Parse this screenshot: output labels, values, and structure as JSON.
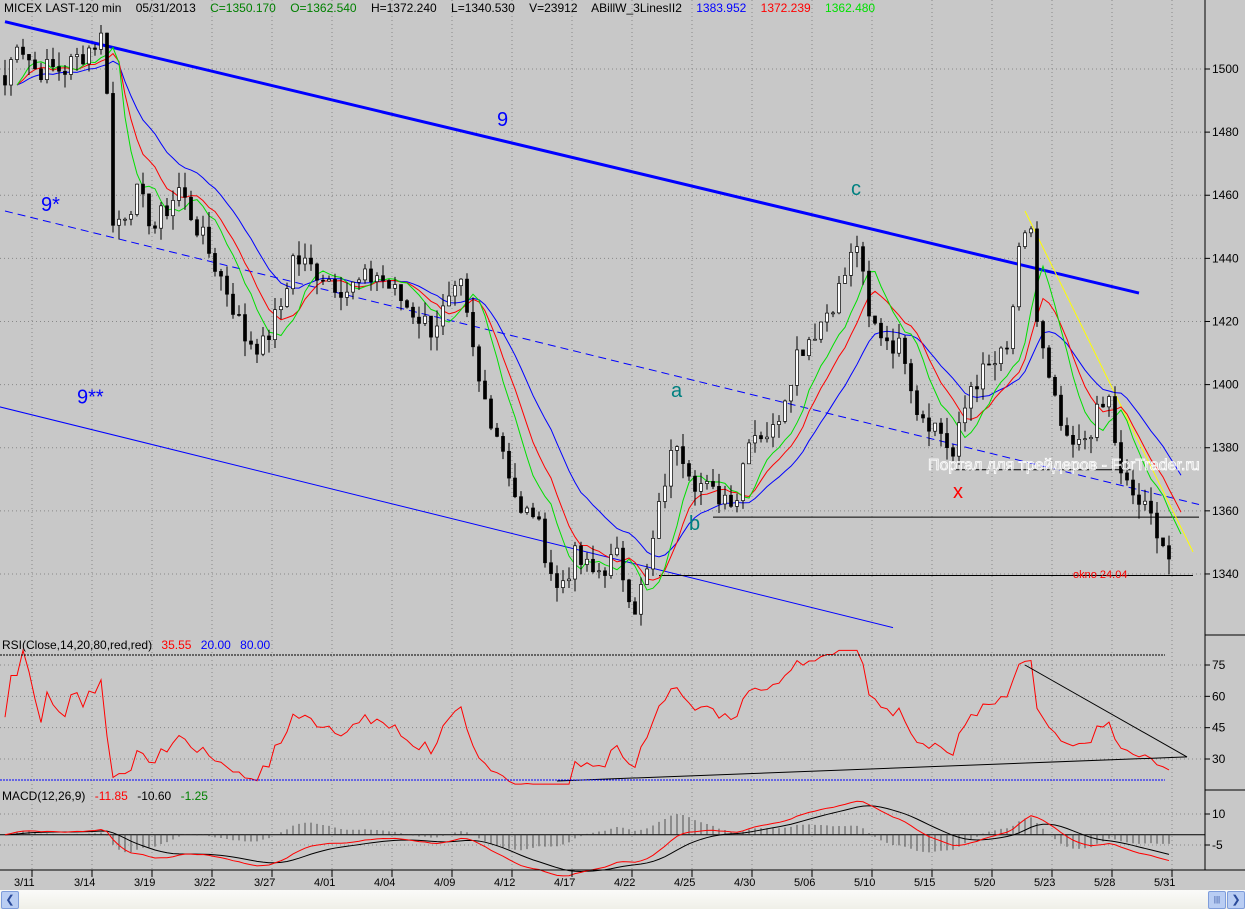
{
  "header": {
    "symbol": "MICEX LAST-120 min",
    "date": "05/31/2013",
    "close": "C=1350.170",
    "open": "O=1362.540",
    "high": "H=1372.240",
    "low": "L=1340.530",
    "volume": "V=23912",
    "indicator": "ABillW_3LinesII2",
    "ma_blue": "1383.952",
    "ma_red": "1372.239",
    "ma_green": "1362.480"
  },
  "rsi_header": {
    "label": "RSI(Close,14,20,80,red,red)",
    "value": "35.55",
    "low": "20.00",
    "high": "80.00"
  },
  "macd_header": {
    "label": "MACD(12,26,9)",
    "macd": "-11.85",
    "signal": "-10.60",
    "hist": "-1.25"
  },
  "watermark": "Портал для трейдеров - ForTrader.ru",
  "colors": {
    "bg": "#c8c8c8",
    "ma_fast": "#00e000",
    "ma_mid": "#ff0000",
    "ma_slow": "#0000ff",
    "trend": "#0000ff",
    "rsi": "#ff0000"
  },
  "chart_data": {
    "type": "candlestick",
    "title": "MICEX LAST-120 min",
    "price_ticks": [
      1340,
      1360,
      1380,
      1400,
      1420,
      1440,
      1460,
      1480,
      1500
    ],
    "ylim": [
      1318,
      1522
    ],
    "rsi_ticks": [
      "75",
      "60",
      "45",
      "30"
    ],
    "macd_ticks": [
      "10",
      "-5"
    ],
    "x_labels": [
      "3/11",
      "3/14",
      "3/19",
      "3/22",
      "3/27",
      "4/01",
      "4/04",
      "4/09",
      "4/12",
      "4/17",
      "4/22",
      "4/25",
      "4/30",
      "5/06",
      "5/10",
      "5/15",
      "5/20",
      "5/23",
      "5/28",
      "5/31"
    ],
    "close_path": [
      [
        0,
        1495
      ],
      [
        2,
        1510
      ],
      [
        5,
        1500
      ],
      [
        10,
        1500
      ],
      [
        16,
        1510
      ],
      [
        17,
        1495
      ],
      [
        18,
        1450
      ],
      [
        22,
        1460
      ],
      [
        25,
        1450
      ],
      [
        29,
        1462
      ],
      [
        32,
        1450
      ],
      [
        37,
        1430
      ],
      [
        40,
        1415
      ],
      [
        43,
        1412
      ],
      [
        46,
        1425
      ],
      [
        48,
        1440
      ],
      [
        53,
        1435
      ],
      [
        57,
        1430
      ],
      [
        62,
        1435
      ],
      [
        67,
        1425
      ],
      [
        71,
        1418
      ],
      [
        76,
        1430
      ],
      [
        79,
        1400
      ],
      [
        83,
        1380
      ],
      [
        86,
        1358
      ],
      [
        88,
        1360
      ],
      [
        92,
        1335
      ],
      [
        95,
        1345
      ],
      [
        98,
        1340
      ],
      [
        102,
        1345
      ],
      [
        105,
        1330
      ],
      [
        107,
        1340
      ],
      [
        110,
        1370
      ],
      [
        112,
        1383
      ],
      [
        115,
        1370
      ],
      [
        118,
        1365
      ],
      [
        122,
        1365
      ],
      [
        124,
        1385
      ],
      [
        128,
        1385
      ],
      [
        132,
        1410
      ],
      [
        136,
        1420
      ],
      [
        139,
        1430
      ],
      [
        142,
        1445
      ],
      [
        144,
        1420
      ],
      [
        147,
        1415
      ],
      [
        150,
        1410
      ],
      [
        152,
        1393
      ],
      [
        156,
        1385
      ],
      [
        158,
        1377
      ],
      [
        161,
        1400
      ],
      [
        164,
        1405
      ],
      [
        167,
        1410
      ],
      [
        169,
        1440
      ],
      [
        171,
        1450
      ],
      [
        172,
        1420
      ],
      [
        174,
        1400
      ],
      [
        177,
        1380
      ],
      [
        179,
        1380
      ],
      [
        182,
        1390
      ],
      [
        184,
        1395
      ],
      [
        186,
        1370
      ],
      [
        188,
        1365
      ],
      [
        192,
        1355
      ],
      [
        194,
        1345
      ]
    ],
    "trendlines": [
      {
        "name": "9",
        "from": [
          0,
          1515
        ],
        "to": [
          189,
          1429
        ],
        "style": "bold"
      },
      {
        "name": "9*",
        "from": [
          0,
          1455
        ],
        "to": [
          199,
          1362
        ],
        "style": "dashed"
      },
      {
        "name": "9**",
        "from": [
          -1,
          1393
        ],
        "to": [
          148,
          1323
        ],
        "style": "thin"
      }
    ],
    "levels": [
      {
        "price": 1373,
        "from": 158,
        "to": 188
      },
      {
        "price": 1358,
        "from": 118,
        "to": 199
      },
      {
        "price": 1339.5,
        "from": 109,
        "to": 198
      }
    ],
    "yellow_line": {
      "from": [
        170,
        1455
      ],
      "to": [
        198,
        1347
      ]
    },
    "annotations": [
      {
        "text": "9",
        "at": [
          82,
          1482
        ],
        "color": "#0000ff"
      },
      {
        "text": "9*",
        "at": [
          6,
          1455
        ],
        "color": "#0000ff"
      },
      {
        "text": "9**",
        "at": [
          12,
          1394
        ],
        "color": "#0000ff"
      },
      {
        "text": "c",
        "at": [
          141,
          1460
        ],
        "color": "#008080"
      },
      {
        "text": "a",
        "at": [
          111,
          1396
        ],
        "color": "#008080"
      },
      {
        "text": "b",
        "at": [
          114,
          1354
        ],
        "color": "#008080"
      },
      {
        "text": "x",
        "at": [
          158,
          1364
        ],
        "color": "#ff0000"
      },
      {
        "text": "okno 24.04",
        "at": [
          178,
          1340
        ],
        "color": "#ff0000"
      }
    ],
    "rsi_lines": [
      {
        "from": [
          170,
          75
        ],
        "to": [
          197,
          31
        ]
      },
      {
        "from": [
          92,
          19.5
        ],
        "to": [
          197,
          31
        ]
      }
    ]
  }
}
